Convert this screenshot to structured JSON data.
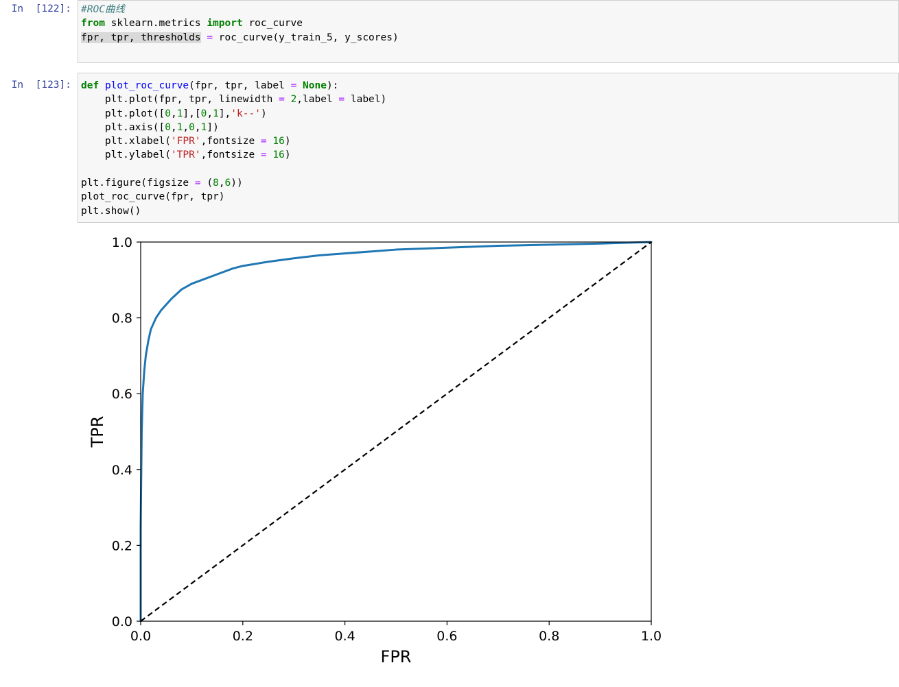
{
  "cells": [
    {
      "prompt": "In  [122]:",
      "lines": [
        [
          {
            "t": "#ROC曲线",
            "c": "cmt"
          }
        ],
        [
          {
            "t": "from",
            "c": "kw"
          },
          {
            "t": " sklearn.metrics ",
            "c": ""
          },
          {
            "t": "import",
            "c": "kw"
          },
          {
            "t": " roc_curve",
            "c": ""
          }
        ],
        [
          {
            "t": "fpr, tpr, thresholds",
            "c": "sel"
          },
          {
            "t": " ",
            "c": ""
          },
          {
            "t": "=",
            "c": "op"
          },
          {
            "t": " roc_curve(y_train_5, y_scores)",
            "c": ""
          }
        ]
      ]
    },
    {
      "prompt": "In  [123]:",
      "lines": [
        [
          {
            "t": "def",
            "c": "kw"
          },
          {
            "t": " ",
            "c": ""
          },
          {
            "t": "plot_roc_curve",
            "c": "fn"
          },
          {
            "t": "(fpr, tpr, label ",
            "c": ""
          },
          {
            "t": "=",
            "c": "op"
          },
          {
            "t": " ",
            "c": ""
          },
          {
            "t": "None",
            "c": "kw"
          },
          {
            "t": "):",
            "c": ""
          }
        ],
        [
          {
            "t": "    plt.plot(fpr, tpr, linewidth ",
            "c": ""
          },
          {
            "t": "=",
            "c": "op"
          },
          {
            "t": " ",
            "c": ""
          },
          {
            "t": "2",
            "c": "num"
          },
          {
            "t": ",label ",
            "c": ""
          },
          {
            "t": "=",
            "c": "op"
          },
          {
            "t": " label)",
            "c": ""
          }
        ],
        [
          {
            "t": "    plt.plot([",
            "c": ""
          },
          {
            "t": "0",
            "c": "num"
          },
          {
            "t": ",",
            "c": ""
          },
          {
            "t": "1",
            "c": "num"
          },
          {
            "t": "],[",
            "c": ""
          },
          {
            "t": "0",
            "c": "num"
          },
          {
            "t": ",",
            "c": ""
          },
          {
            "t": "1",
            "c": "num"
          },
          {
            "t": "],",
            "c": ""
          },
          {
            "t": "'k--'",
            "c": "str"
          },
          {
            "t": ")",
            "c": ""
          }
        ],
        [
          {
            "t": "    plt.axis([",
            "c": ""
          },
          {
            "t": "0",
            "c": "num"
          },
          {
            "t": ",",
            "c": ""
          },
          {
            "t": "1",
            "c": "num"
          },
          {
            "t": ",",
            "c": ""
          },
          {
            "t": "0",
            "c": "num"
          },
          {
            "t": ",",
            "c": ""
          },
          {
            "t": "1",
            "c": "num"
          },
          {
            "t": "])",
            "c": ""
          }
        ],
        [
          {
            "t": "    plt.xlabel(",
            "c": ""
          },
          {
            "t": "'FPR'",
            "c": "str"
          },
          {
            "t": ",fontsize ",
            "c": ""
          },
          {
            "t": "=",
            "c": "op"
          },
          {
            "t": " ",
            "c": ""
          },
          {
            "t": "16",
            "c": "num"
          },
          {
            "t": ")",
            "c": ""
          }
        ],
        [
          {
            "t": "    plt.ylabel(",
            "c": ""
          },
          {
            "t": "'TPR'",
            "c": "str"
          },
          {
            "t": ",fontsize ",
            "c": ""
          },
          {
            "t": "=",
            "c": "op"
          },
          {
            "t": " ",
            "c": ""
          },
          {
            "t": "16",
            "c": "num"
          },
          {
            "t": ")",
            "c": ""
          }
        ],
        [],
        [
          {
            "t": "plt.figure(figsize ",
            "c": ""
          },
          {
            "t": "=",
            "c": "op"
          },
          {
            "t": " (",
            "c": ""
          },
          {
            "t": "8",
            "c": "num"
          },
          {
            "t": ",",
            "c": ""
          },
          {
            "t": "6",
            "c": "num"
          },
          {
            "t": "))",
            "c": ""
          }
        ],
        [
          {
            "t": "plot_roc_curve(fpr, tpr)",
            "c": ""
          }
        ],
        [
          {
            "t": "plt.show()",
            "c": ""
          }
        ]
      ]
    }
  ],
  "chart_data": {
    "type": "line",
    "title": "",
    "xlabel": "FPR",
    "ylabel": "TPR",
    "xlim": [
      0.0,
      1.0
    ],
    "ylim": [
      0.0,
      1.0
    ],
    "xticks": [
      "0.0",
      "0.2",
      "0.4",
      "0.6",
      "0.8",
      "1.0"
    ],
    "yticks": [
      "0.0",
      "0.2",
      "0.4",
      "0.6",
      "0.8",
      "1.0"
    ],
    "grid": false,
    "series": [
      {
        "color": "#1f77b4",
        "style": "solid",
        "x": [
          0.0,
          0.0,
          0.002,
          0.004,
          0.007,
          0.01,
          0.015,
          0.02,
          0.03,
          0.04,
          0.05,
          0.06,
          0.08,
          0.1,
          0.12,
          0.15,
          0.18,
          0.2,
          0.25,
          0.3,
          0.35,
          0.4,
          0.45,
          0.5,
          0.6,
          0.7,
          0.8,
          0.9,
          1.0
        ],
        "y": [
          0.0,
          0.25,
          0.5,
          0.6,
          0.66,
          0.7,
          0.74,
          0.77,
          0.8,
          0.82,
          0.835,
          0.85,
          0.875,
          0.89,
          0.9,
          0.915,
          0.93,
          0.937,
          0.948,
          0.957,
          0.965,
          0.97,
          0.975,
          0.98,
          0.985,
          0.99,
          0.993,
          0.996,
          1.0
        ]
      },
      {
        "color": "#000000",
        "style": "dashed",
        "x": [
          0.0,
          1.0
        ],
        "y": [
          0.0,
          1.0
        ]
      }
    ]
  }
}
